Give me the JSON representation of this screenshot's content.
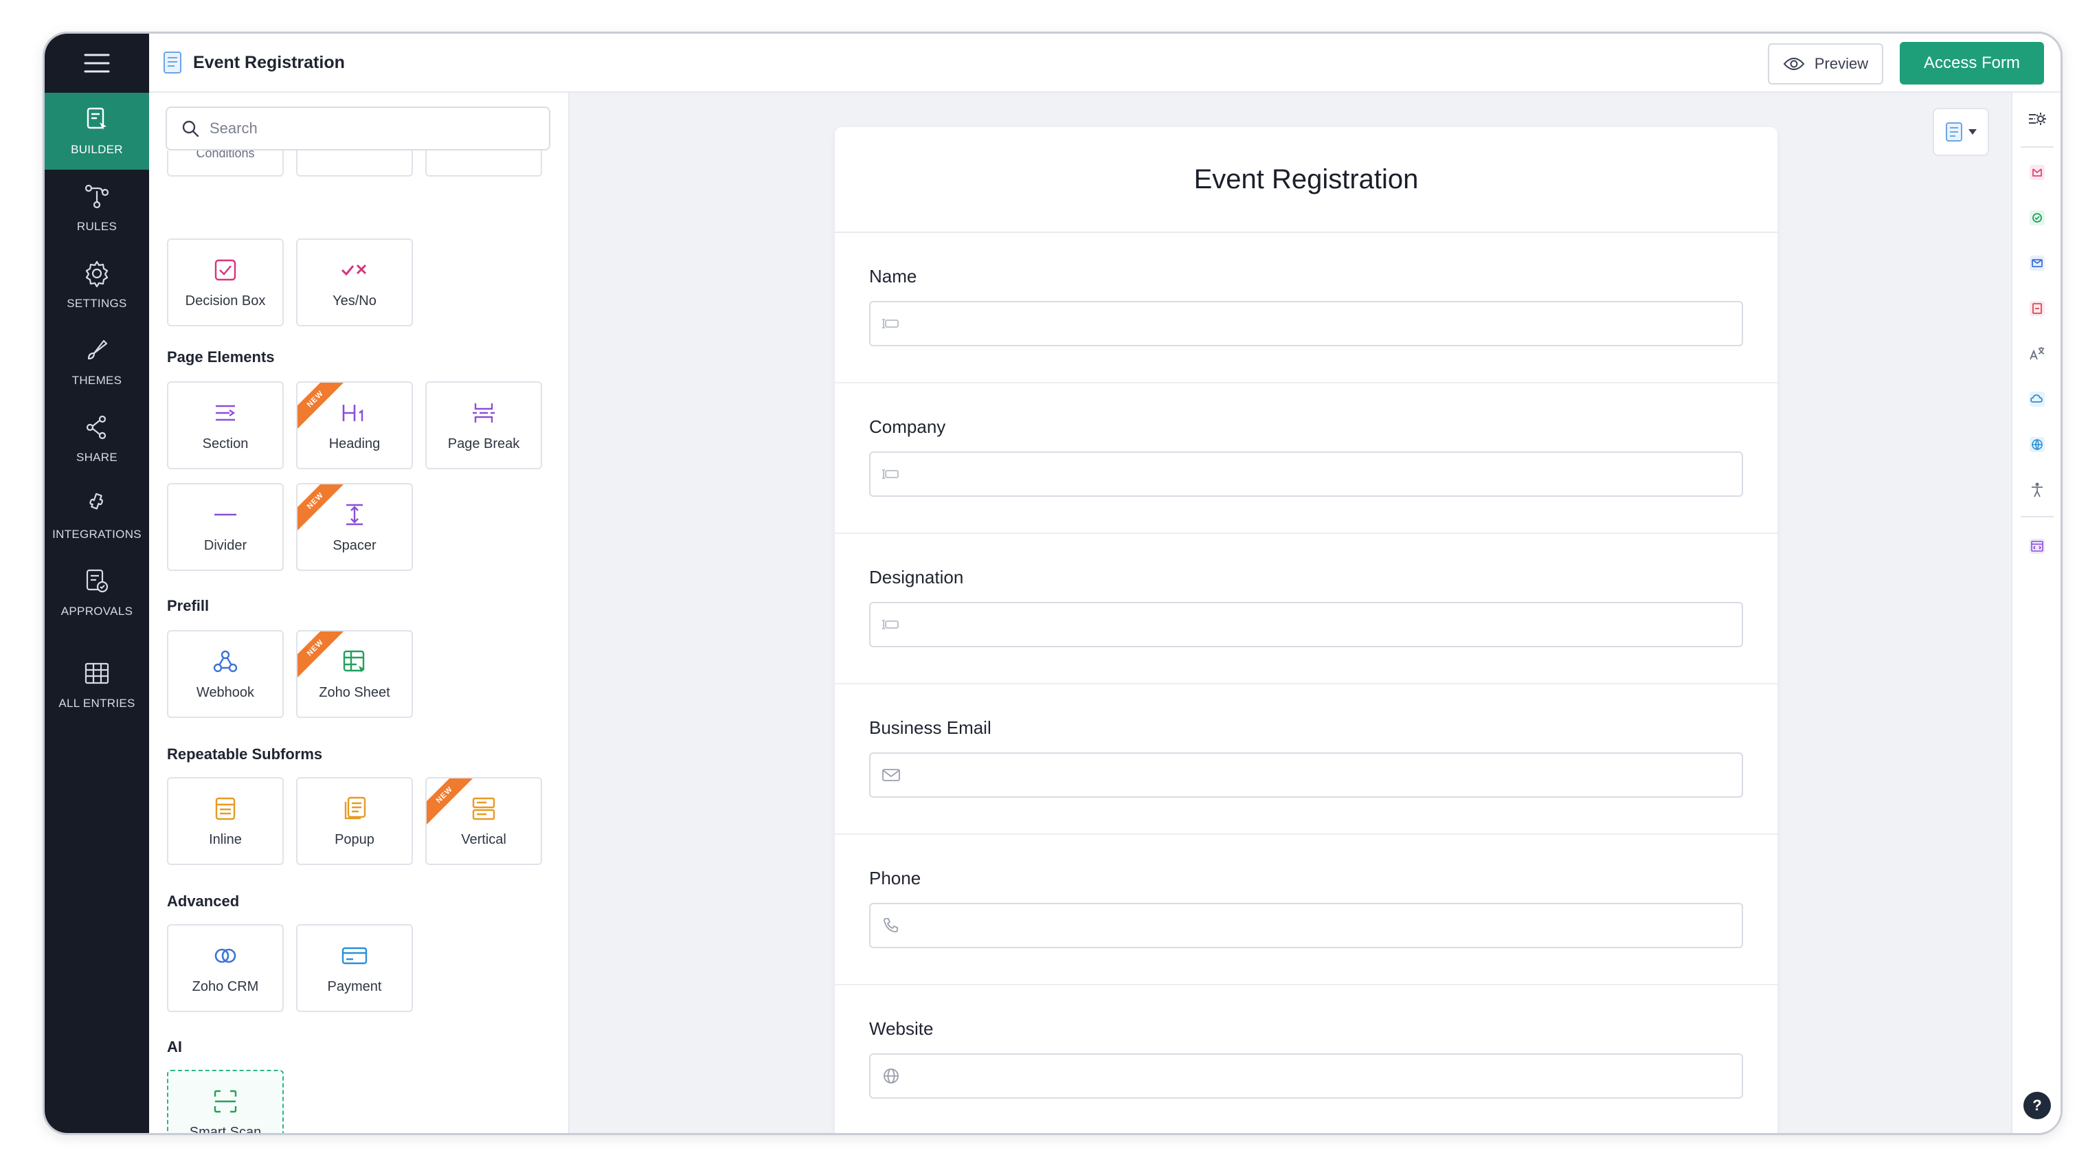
{
  "app": {
    "title": "Event Registration",
    "preview_label": "Preview",
    "access_form_label": "Access Form"
  },
  "nav": {
    "items": [
      {
        "label": "BUILDER",
        "icon": "builder-icon",
        "active": true
      },
      {
        "label": "RULES",
        "icon": "rules-icon"
      },
      {
        "label": "SETTINGS",
        "icon": "gear-icon"
      },
      {
        "label": "THEMES",
        "icon": "brush-icon"
      },
      {
        "label": "SHARE",
        "icon": "share-icon"
      },
      {
        "label": "INTEGRATIONS",
        "icon": "integrations-icon"
      },
      {
        "label": "APPROVALS",
        "icon": "approvals-icon"
      },
      {
        "label": "ALL ENTRIES",
        "icon": "table-icon"
      }
    ]
  },
  "panel": {
    "search_placeholder": "Search",
    "cut_tile_label": "Conditions",
    "top_tiles": [
      "Decision Box",
      "Yes/No"
    ],
    "groups": [
      {
        "title": "Page Elements",
        "tiles": [
          "Section",
          "Heading",
          "Page Break",
          "Divider",
          "Spacer"
        ]
      },
      {
        "title": "Prefill",
        "tiles": [
          "Webhook",
          "Zoho Sheet"
        ]
      },
      {
        "title": "Repeatable Subforms",
        "tiles": [
          "Inline",
          "Popup",
          "Vertical"
        ]
      },
      {
        "title": "Advanced",
        "tiles": [
          "Zoho CRM",
          "Payment"
        ]
      },
      {
        "title": "AI",
        "tiles": [
          "Smart Scan"
        ]
      }
    ],
    "new_badge": "NEW"
  },
  "form": {
    "title": "Event Registration",
    "fields": [
      {
        "label": "Name",
        "icon": "text-field-icon"
      },
      {
        "label": "Company",
        "icon": "text-field-icon"
      },
      {
        "label": "Designation",
        "icon": "text-field-icon"
      },
      {
        "label": "Business Email",
        "icon": "mail-icon"
      },
      {
        "label": "Phone",
        "icon": "phone-icon"
      },
      {
        "label": "Website",
        "icon": "globe-icon"
      }
    ]
  },
  "help_label": "?",
  "colors": {
    "nav_bg": "#161b26",
    "accent": "#1f9e7a",
    "new_badge": "#f07a2e"
  }
}
